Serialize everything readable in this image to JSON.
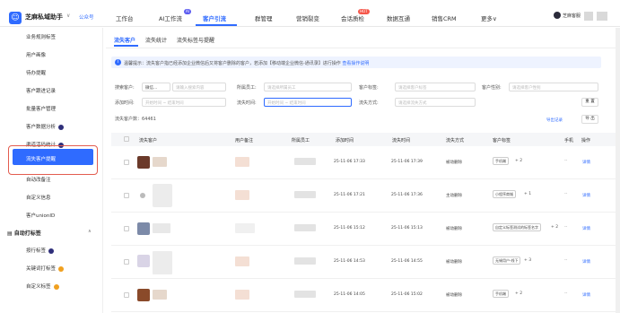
{
  "header": {
    "app_name": "芝麻私域助手",
    "app_chevron": "∨",
    "public_account": "公众号",
    "nav_tabs": [
      "工作台",
      "AI工作流",
      "客户引流",
      "群管理",
      "营销裂变",
      "会话质检",
      "数据互通",
      "销售CRM",
      "更多∨"
    ],
    "ai_badge": "AI",
    "hot_badge": "HOT",
    "user_name": "芝麻客服",
    "accent_color": "#2f6bff"
  },
  "sidebar": {
    "items": [
      "业务规则标签",
      "用户画像",
      "待办提醒",
      "客户跟进记录",
      "批量客户管理",
      "客户数据分析",
      "渠道活码统计",
      "流失客户提醒",
      "自动改备注",
      "自定义信息",
      "客户unionID"
    ],
    "active": "流失客户提醒",
    "section_title": "自动打标签",
    "section_chevron": "∧",
    "section_items": [
      "按行标签",
      "关键词打标签",
      "自定义标签"
    ]
  },
  "content": {
    "subtabs": [
      "流失客户",
      "流失统计",
      "流失标签与提醒"
    ],
    "notice": "温馨提示：流失客户指已经添加企业微信后又将客户删除的客户，若添加【移动端企业微信-通讯录】进行操作",
    "notice_link": "查看操作说明",
    "filters": {
      "search_label": "搜索客户:",
      "search_type": "微信...",
      "search_placeholder": "请输入搜索内容",
      "staff_label": "所属员工:",
      "staff_placeholder": "请选择所属员工",
      "tag_label": "客户标签:",
      "tag_placeholder": "请选择客户标签",
      "gender_label": "客户性别:",
      "gender_placeholder": "请选择客户性别",
      "add_time_label": "添加时间:",
      "start_placeholder": "开始时间",
      "end_placeholder": "结束时间",
      "sep": "~",
      "lost_time_label": "流失时间:",
      "method_label": "流失方式:",
      "method_placeholder": "请选择流失方式",
      "reset_button": "重 置"
    },
    "count_label": "流失客户数：64461",
    "export_link": "导出记录",
    "export_button": "导 出",
    "table": {
      "columns": [
        "流失客户",
        "用户备注",
        "所属员工",
        "添加时间",
        "流失时间",
        "流失方式",
        "客户标签",
        "手机",
        "操作"
      ],
      "rows": [
        {
          "add_time": "25-11-06 17:33",
          "lost_time": "25-11-06 17:39",
          "method": "被动删除",
          "tag": "手机端",
          "more": "+ 2",
          "action": "详情"
        },
        {
          "add_time": "25-11-06 17:21",
          "lost_time": "25-11-06 17:36",
          "method": "主动删除",
          "tag": "小程序商城",
          "more": "+ 1",
          "action": "详情"
        },
        {
          "add_time": "25-11-06 15:12",
          "lost_time": "25-11-06 15:13",
          "method": "被动删除",
          "tag": "自定义标签测试的标签名字",
          "more": "+ 2",
          "action": "详情"
        },
        {
          "add_time": "25-11-06 14:53",
          "lost_time": "25-11-06 14:55",
          "method": "被动删除",
          "tag": "无锡用户-线下",
          "more": "+ 3",
          "action": "详情"
        },
        {
          "add_time": "25-11-06 14:05",
          "lost_time": "25-11-06 15:02",
          "method": "被动删除",
          "tag": "手机端",
          "more": "+ 2",
          "action": "详情"
        }
      ]
    }
  }
}
